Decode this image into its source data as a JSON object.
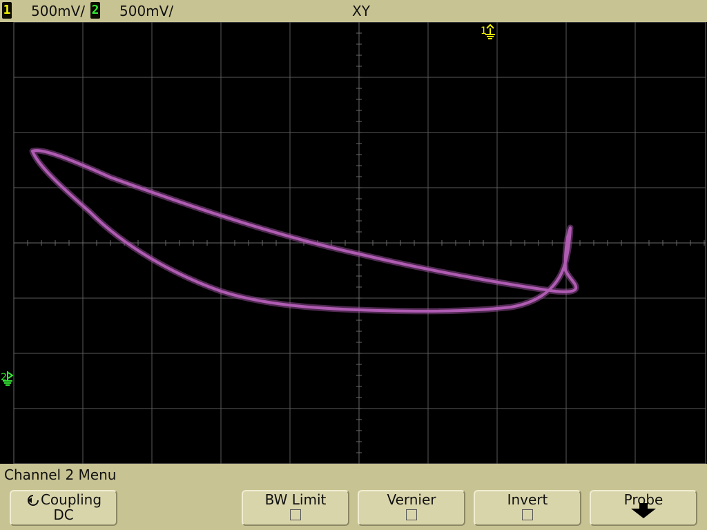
{
  "status_bar": {
    "channel1": {
      "number": "1",
      "scale": "500mV/",
      "color": "#f2f200"
    },
    "channel2": {
      "number": "2",
      "scale": "500mV/",
      "color": "#33e633"
    },
    "mode": "XY"
  },
  "screen": {
    "trace_color": "#b05cb3",
    "ch1_marker": "1",
    "ch2_marker": "2",
    "ch1_marker_icon": "ground-arrow-up-icon",
    "ch2_marker_icon": "ground-arrow-right-icon"
  },
  "menu": {
    "title": "Channel 2  Menu",
    "softkeys": [
      {
        "label": "Coupling",
        "value": "DC",
        "icon": "cycle-arrow-icon"
      },
      {
        "label": "BW Limit",
        "checked": false
      },
      {
        "label": "Vernier",
        "checked": false
      },
      {
        "label": "Invert",
        "checked": false
      },
      {
        "label": "Probe",
        "icon": "down-arrow-icon"
      }
    ]
  }
}
